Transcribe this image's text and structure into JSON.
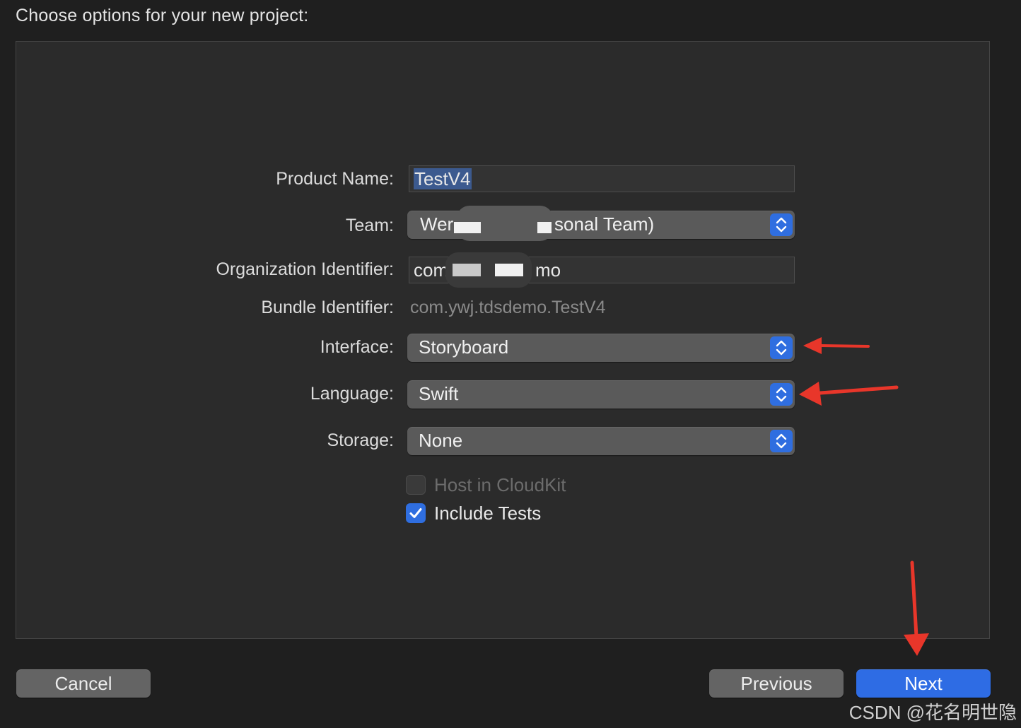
{
  "header": {
    "title": "Choose options for your new project:"
  },
  "form": {
    "product_name": {
      "label": "Product Name:",
      "value": "TestV4"
    },
    "team": {
      "label": "Team:",
      "value_start": "Wer",
      "value_end": "sonal Team)"
    },
    "organization_identifier": {
      "label": "Organization Identifier:",
      "value_start": "com",
      "value_end": "mo"
    },
    "bundle_identifier": {
      "label": "Bundle Identifier:",
      "value": "com.ywj.tdsdemo.TestV4"
    },
    "interface": {
      "label": "Interface:",
      "value": "Storyboard"
    },
    "language": {
      "label": "Language:",
      "value": "Swift"
    },
    "storage": {
      "label": "Storage:",
      "value": "None"
    },
    "host_in_cloudkit": {
      "label": "Host in CloudKit",
      "checked": false,
      "enabled": false
    },
    "include_tests": {
      "label": "Include Tests",
      "checked": true,
      "enabled": true
    }
  },
  "buttons": {
    "cancel": "Cancel",
    "previous": "Previous",
    "next": "Next"
  },
  "watermark": "CSDN @花名明世隐",
  "colors": {
    "accent": "#2e6ce4",
    "annotation_arrow": "#e8362a"
  }
}
